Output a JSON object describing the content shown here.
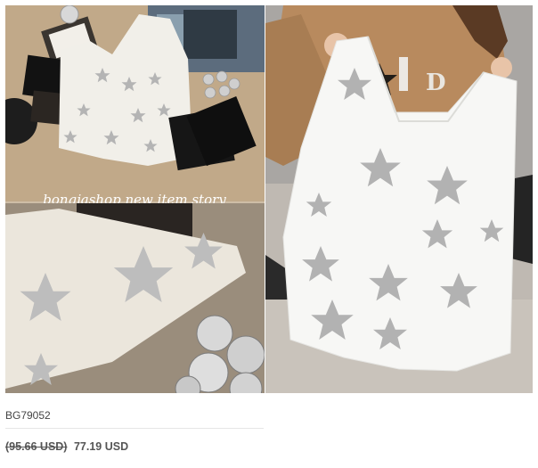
{
  "product": {
    "left_image_caption": "bongjashop new item story",
    "sku": "BG79052",
    "old_price": "(95.66 USD)",
    "new_price": "77.19 USD"
  },
  "colors": {
    "accent": "#c9a64a",
    "silver": "#b8b8b8",
    "text": "#555555"
  }
}
